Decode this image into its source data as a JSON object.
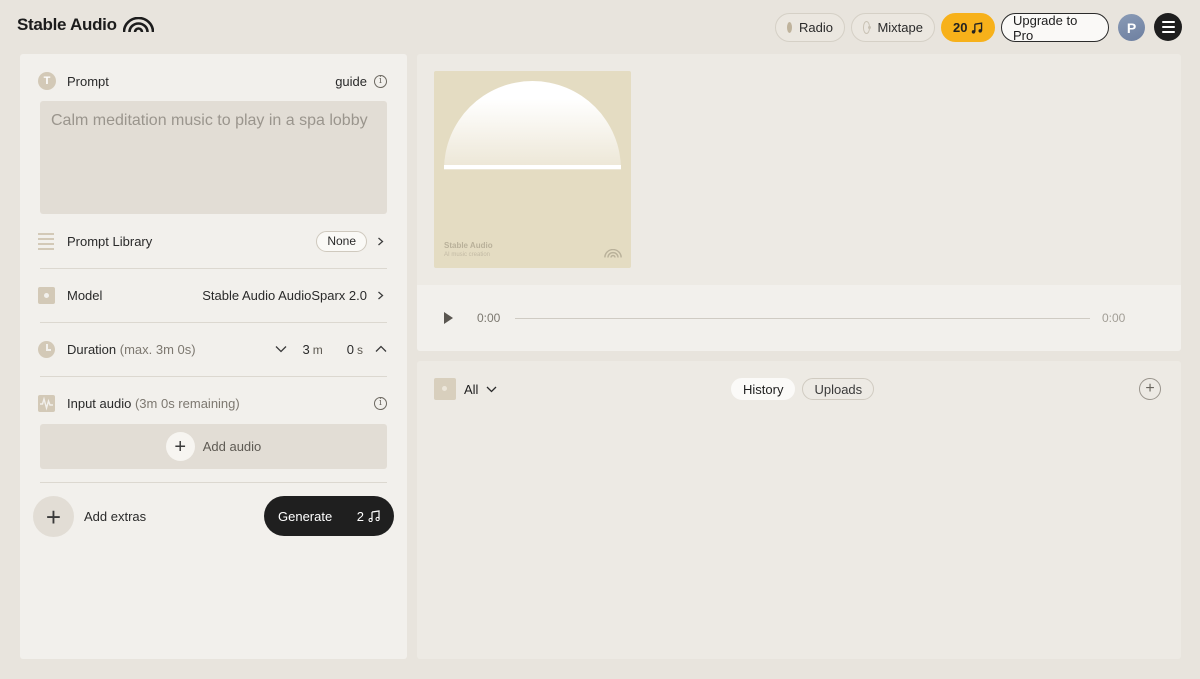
{
  "header": {
    "logo_text": "Stable Audio",
    "radio_label": "Radio",
    "mixtape_label": "Mixtape",
    "credits": "20",
    "upgrade_label": "Upgrade to Pro",
    "avatar_initial": "P"
  },
  "prompt": {
    "label": "Prompt",
    "guide_label": "guide",
    "placeholder": "Calm meditation music to play in a spa lobby"
  },
  "prompt_library": {
    "label": "Prompt Library",
    "value": "None"
  },
  "model": {
    "label": "Model",
    "value": "Stable Audio AudioSparx 2.0"
  },
  "duration": {
    "label": "Duration",
    "hint": "(max. 3m 0s)",
    "minutes": "3",
    "minutes_unit": "m",
    "seconds": "0",
    "seconds_unit": "s"
  },
  "input_audio": {
    "label": "Input audio",
    "hint": "(3m 0s remaining)",
    "add_label": "Add audio"
  },
  "actions": {
    "extras_label": "Add extras",
    "generate_label": "Generate",
    "generate_cost": "2"
  },
  "cover": {
    "title": "Stable Audio",
    "subtitle": "AI music creation"
  },
  "player": {
    "current_time": "0:00",
    "total_time": "0:00"
  },
  "library": {
    "filter_label": "All",
    "tabs": [
      {
        "label": "History",
        "active": true
      },
      {
        "label": "Uploads",
        "active": false
      }
    ]
  },
  "colors": {
    "background": "#e8e4dd",
    "panel": "#f2f0ec",
    "credits_accent": "#f7b11a",
    "generate_button": "#1f1f1f"
  },
  "icons": [
    "logo-mark-icon",
    "radio-icon",
    "mixtape-icon",
    "music-note-icon",
    "menu-icon",
    "text-icon",
    "info-icon",
    "list-icon",
    "chevron-right-icon",
    "model-icon",
    "clock-icon",
    "chevron-down-icon",
    "chevron-up-icon",
    "waveform-icon",
    "plus-icon",
    "play-icon",
    "filter-icon"
  ]
}
